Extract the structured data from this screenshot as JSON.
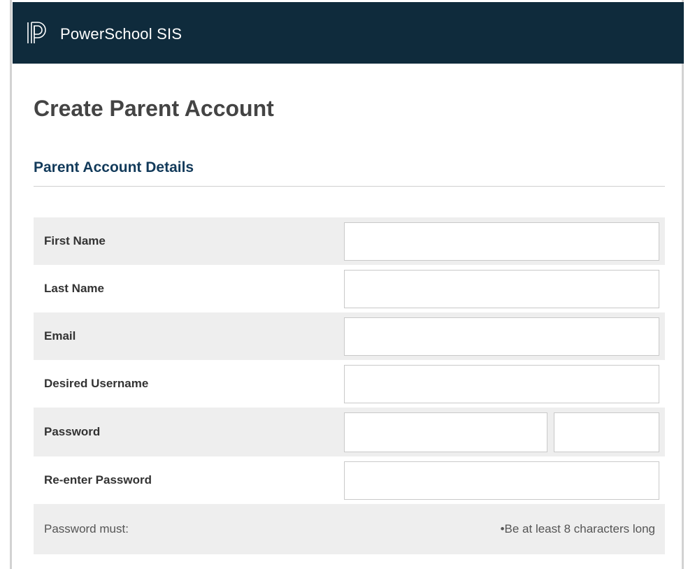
{
  "header": {
    "brand": "PowerSchool SIS",
    "logo_icon": "powerschool-logo-icon",
    "background_color": "#0f2b3c"
  },
  "page": {
    "title": "Create Parent Account"
  },
  "section": {
    "title": "Parent Account Details"
  },
  "form": {
    "first_name": {
      "label": "First Name",
      "value": ""
    },
    "last_name": {
      "label": "Last Name",
      "value": ""
    },
    "email": {
      "label": "Email",
      "value": ""
    },
    "username": {
      "label": "Desired Username",
      "value": ""
    },
    "password": {
      "label": "Password",
      "value": ""
    },
    "password_confirm": {
      "label": "Re-enter Password",
      "value": ""
    }
  },
  "password_rules": {
    "label": "Password must:",
    "items": [
      "•Be at least 8 characters long"
    ]
  }
}
